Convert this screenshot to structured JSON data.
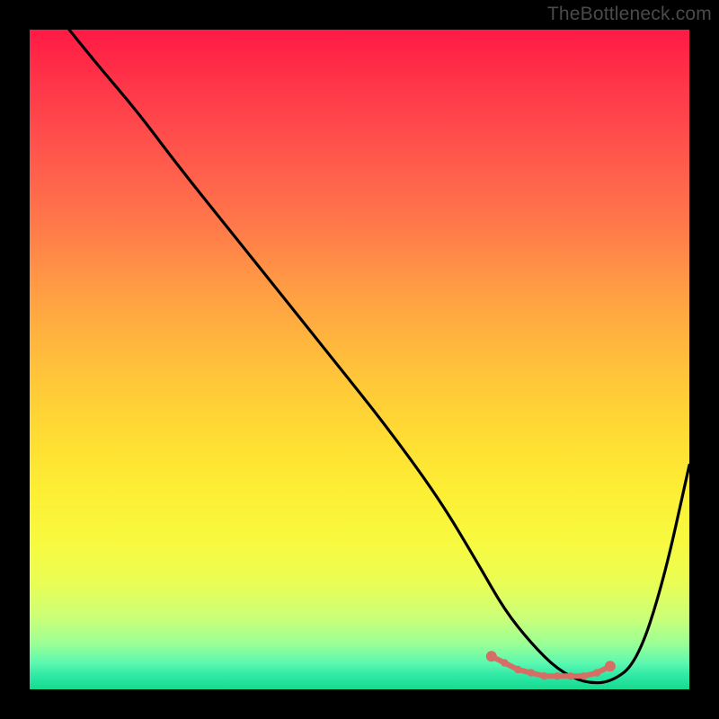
{
  "watermark": "TheBottleneck.com",
  "colors": {
    "frame_bg": "#000000",
    "curve_primary": "#000000",
    "marker": "#d66e65"
  },
  "chart_data": {
    "type": "line",
    "title": "",
    "xlabel": "",
    "ylabel": "",
    "xlim": [
      0,
      100
    ],
    "ylim": [
      0,
      100
    ],
    "grid": false,
    "legend": false,
    "background_gradient": [
      {
        "stop": 0,
        "color": "#ff1a44"
      },
      {
        "stop": 10,
        "color": "#ff3b4a"
      },
      {
        "stop": 20,
        "color": "#ff5a4c"
      },
      {
        "stop": 30,
        "color": "#ff7a4a"
      },
      {
        "stop": 38,
        "color": "#ff9845"
      },
      {
        "stop": 46,
        "color": "#ffb23f"
      },
      {
        "stop": 54,
        "color": "#ffc938"
      },
      {
        "stop": 62,
        "color": "#ffdd33"
      },
      {
        "stop": 70,
        "color": "#fdef34"
      },
      {
        "stop": 78,
        "color": "#f7fa40"
      },
      {
        "stop": 84,
        "color": "#e9fd55"
      },
      {
        "stop": 89,
        "color": "#ccff77"
      },
      {
        "stop": 93,
        "color": "#9cff95"
      },
      {
        "stop": 96,
        "color": "#5cf8b0"
      },
      {
        "stop": 98,
        "color": "#2ce8a5"
      },
      {
        "stop": 100,
        "color": "#18d98f"
      }
    ],
    "series": [
      {
        "name": "bottleneck-curve",
        "color": "#000000",
        "x": [
          6,
          10,
          16,
          22,
          30,
          38,
          46,
          54,
          62,
          68,
          72,
          76,
          80,
          84,
          88,
          92,
          96,
          100
        ],
        "y": [
          100,
          95,
          88,
          80,
          70,
          60,
          50,
          40,
          29,
          19,
          12,
          7,
          3,
          1,
          1,
          4,
          16,
          34
        ]
      }
    ],
    "markers": {
      "name": "bottom-highlight",
      "color": "#d66e65",
      "x": [
        70,
        72,
        74,
        76,
        78,
        80,
        82,
        84,
        86,
        88
      ],
      "y": [
        5,
        4,
        3,
        2.5,
        2,
        2,
        2,
        2,
        2.5,
        3.5
      ]
    }
  }
}
